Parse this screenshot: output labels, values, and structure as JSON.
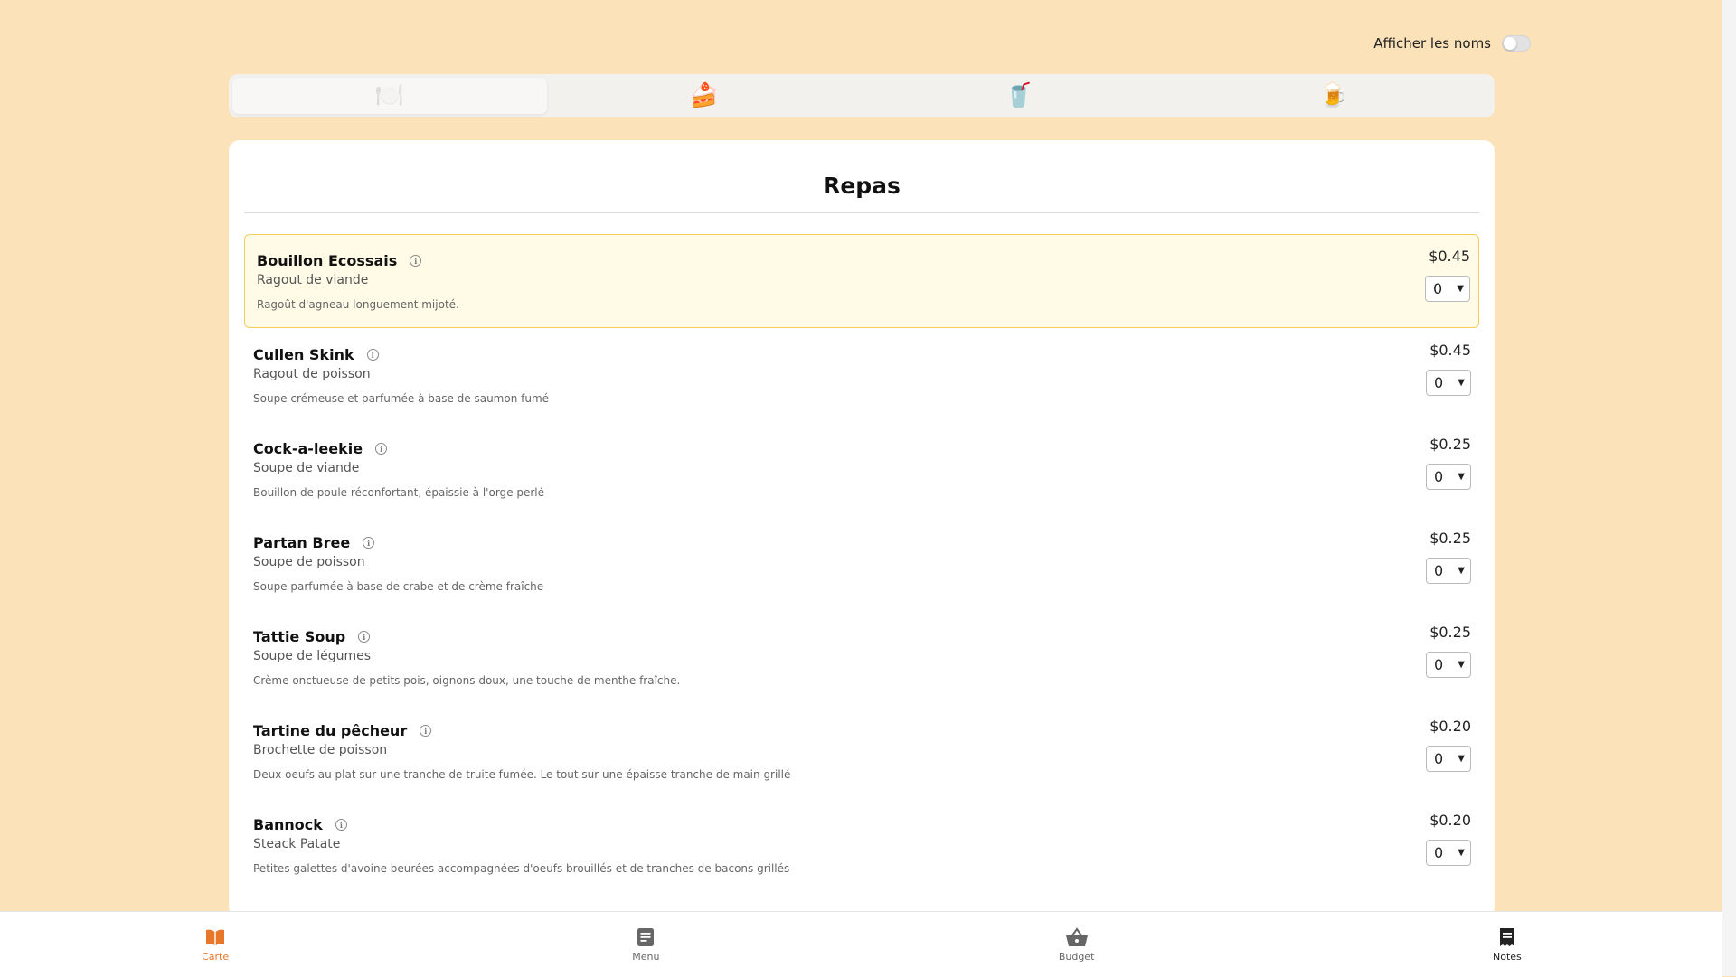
{
  "toggle": {
    "label": "Afficher les noms",
    "on": false
  },
  "tabs": [
    {
      "name": "tab-repas",
      "emoji": "🍽️",
      "icon": "plate-icon"
    },
    {
      "name": "tab-desserts",
      "emoji": "🍰",
      "icon": "cake-icon"
    },
    {
      "name": "tab-boissons",
      "emoji": "🥤",
      "icon": "cup-icon"
    },
    {
      "name": "tab-bieres",
      "emoji": "🍺",
      "icon": "beer-icon"
    }
  ],
  "section": {
    "title": "Repas"
  },
  "items": [
    {
      "name": "Bouillon Ecossais",
      "subtitle": "Ragout de viande",
      "description": "Ragoût d'agneau longuement mijoté.",
      "price": "$0.45",
      "qty": "0"
    },
    {
      "name": "Cullen Skink",
      "subtitle": "Ragout de poisson",
      "description": "Soupe crémeuse et parfumée à base de saumon fumé",
      "price": "$0.45",
      "qty": "0"
    },
    {
      "name": "Cock-a-leekie",
      "subtitle": "Soupe de viande",
      "description": "Bouillon de poule réconfortant, épaissie à l'orge perlé",
      "price": "$0.25",
      "qty": "0"
    },
    {
      "name": "Partan Bree",
      "subtitle": "Soupe de poisson",
      "description": "Soupe parfumée à base de crabe et de crème fraîche",
      "price": "$0.25",
      "qty": "0"
    },
    {
      "name": "Tattie Soup",
      "subtitle": "Soupe de légumes",
      "description": "Crème onctueuse de petits pois, oignons doux, une touche de menthe fraîche.",
      "price": "$0.25",
      "qty": "0"
    },
    {
      "name": "Tartine du pêcheur",
      "subtitle": "Brochette de poisson",
      "description": "Deux oeufs au plat sur une tranche de truite fumée. Le tout sur une épaisse tranche de main grillé",
      "price": "$0.20",
      "qty": "0"
    },
    {
      "name": "Bannock",
      "subtitle": "Steack Patate",
      "description": "Petites galettes d'avoine beurées accompagnées d'oeufs brouillés et de tranches de bacons grillés",
      "price": "$0.20",
      "qty": "0"
    }
  ],
  "nav": [
    {
      "label": "Carte",
      "icon": "book-icon"
    },
    {
      "label": "Menu",
      "icon": "document-icon"
    },
    {
      "label": "Budget",
      "icon": "basket-icon"
    },
    {
      "label": "Notes",
      "icon": "receipt-icon"
    }
  ],
  "colors": {
    "background": "#fbe2b9",
    "accent": "#e8772a",
    "highlight": "#fffbe6",
    "highlight_border": "#f1cd5e"
  }
}
